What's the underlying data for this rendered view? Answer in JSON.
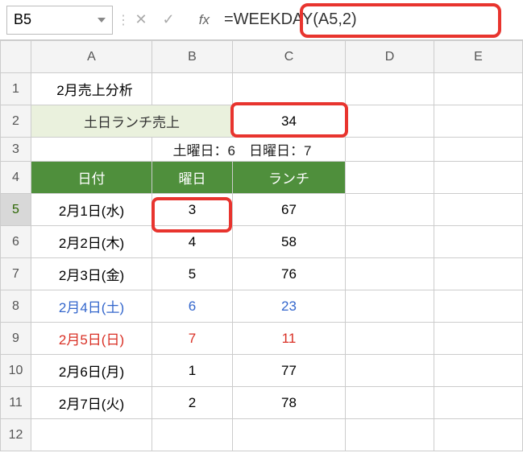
{
  "name_box": "B5",
  "fx_label": "fx",
  "formula": "=WEEKDAY(A5,2)",
  "cols": [
    "A",
    "B",
    "C",
    "D",
    "E"
  ],
  "rows": [
    "1",
    "2",
    "3",
    "4",
    "5",
    "6",
    "7",
    "8",
    "9",
    "10",
    "11",
    "12"
  ],
  "r1": {
    "a": "2月売上分析"
  },
  "r2": {
    "ab": "土日ランチ売上",
    "c": "34"
  },
  "r3": {
    "bc": "土曜日：6　日曜日：7"
  },
  "r4": {
    "a": "日付",
    "b": "曜日",
    "c": "ランチ"
  },
  "dataRows": [
    {
      "date": "2月1日(水)",
      "wd": "3",
      "lunch": "67",
      "cls": ""
    },
    {
      "date": "2月2日(木)",
      "wd": "4",
      "lunch": "58",
      "cls": ""
    },
    {
      "date": "2月3日(金)",
      "wd": "5",
      "lunch": "76",
      "cls": ""
    },
    {
      "date": "2月4日(土)",
      "wd": "6",
      "lunch": "23",
      "cls": "blue"
    },
    {
      "date": "2月5日(日)",
      "wd": "7",
      "lunch": "11",
      "cls": "red"
    },
    {
      "date": "2月6日(月)",
      "wd": "1",
      "lunch": "77",
      "cls": ""
    },
    {
      "date": "2月7日(火)",
      "wd": "2",
      "lunch": "78",
      "cls": ""
    }
  ]
}
